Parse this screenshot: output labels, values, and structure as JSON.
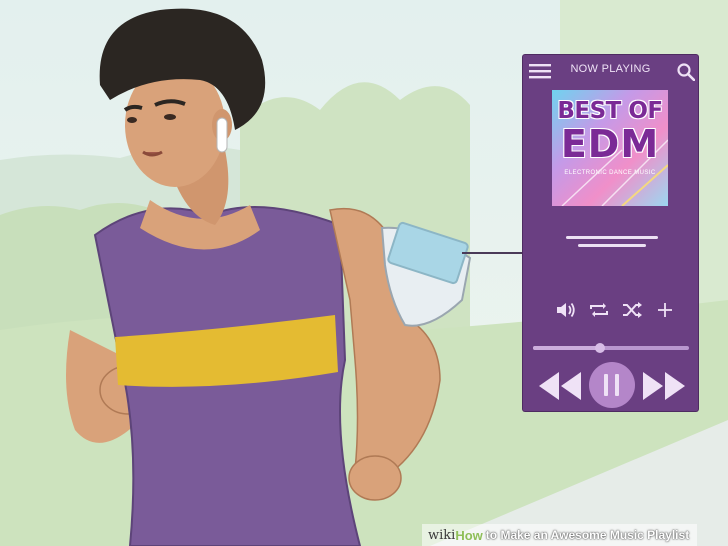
{
  "player": {
    "header_label": "NOW PLAYING",
    "menu_icon": "hamburger-menu-icon",
    "search_icon": "search-icon",
    "album": {
      "title_line1": "BEST OF",
      "title_line2": "EDM",
      "subtitle": "ELECTRONIC DANCE MUSIC"
    },
    "controls": [
      "volume-icon",
      "repeat-icon",
      "shuffle-icon",
      "add-icon"
    ],
    "progress_fraction": 0.43,
    "playback": [
      "rewind-icon",
      "pause-icon",
      "fast-forward-icon"
    ],
    "accent_color": "#6a3f82"
  },
  "caption": {
    "wiki": "wiki",
    "how": "How",
    "rest": "to Make an Awesome Music Playlist"
  }
}
